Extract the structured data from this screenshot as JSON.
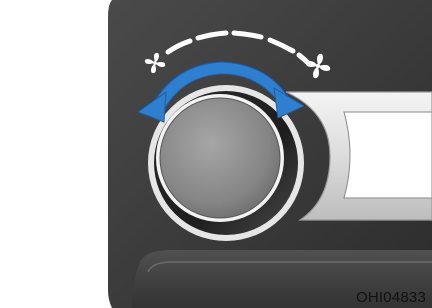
{
  "figure": {
    "reference_code": "OHI04833",
    "subject": "fan-speed-control-knob",
    "rotation": "both-directions",
    "fan_speed_levels": 5,
    "icons": [
      "fan-low-icon",
      "fan-high-icon",
      "rotate-arrow-icon"
    ],
    "colors": {
      "panel": "#3b3b3b",
      "panel_dark": "#2a2a2a",
      "trim": "#e9e9e9",
      "knob": "#8f8f8f",
      "arrow": "#2f7fd0",
      "scale": "#ffffff",
      "page": "#ffffff"
    }
  }
}
